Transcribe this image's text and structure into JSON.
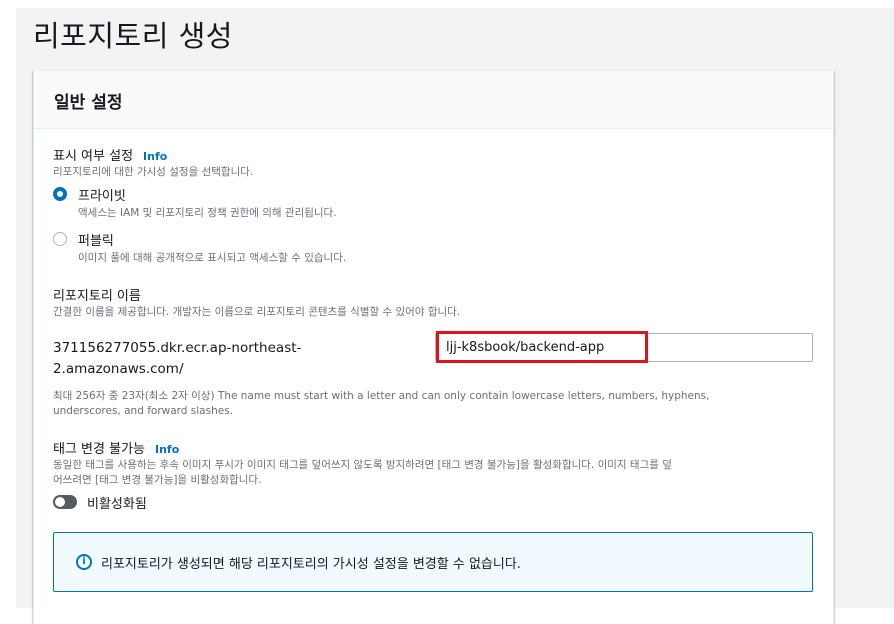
{
  "page": {
    "title": "리포지토리 생성"
  },
  "general_settings": {
    "header": "일반 설정",
    "visibility": {
      "label": "표시 여부 설정",
      "info": "Info",
      "description": "리포지토리에 대한 가시성 설정을 선택합니다.",
      "options": [
        {
          "label": "프라이빗",
          "description": "액세스는 IAM 및 리포지토리 정책 권한에 의해 관리됩니다.",
          "checked": true
        },
        {
          "label": "퍼블릭",
          "description": "이미지 풀에 대해 공개적으로 표시되고 액세스할 수 있습니다.",
          "checked": false
        }
      ]
    },
    "repo_name": {
      "label": "리포지토리 이름",
      "description": "간결한 이름을 제공합니다. 개발자는 이름으로 리포지토리 콘텐츠를 식별할 수 있어야 합니다.",
      "uri_prefix_line1": "371156277055.dkr.ecr.ap-northeast-",
      "uri_prefix_line2": "2.amazonaws.com/",
      "value": "ljj-k8sbook/backend-app",
      "hint_line1": "최대 256자 중 23자(최소 2자 이상) The name must start with a letter and can only contain lowercase letters, numbers, hyphens,",
      "hint_line2": "underscores, and forward slashes."
    },
    "tag_immutability": {
      "label": "태그 변경 불가능",
      "info": "Info",
      "description_line1": "동일한 태그를 사용하는 후속 이미지 푸시가 이미지 태그를 덮어쓰지 않도록 방지하려면 [태그 변경 불가능]을 활성화합니다. 이미지 태그를 덮",
      "description_line2": "어쓰려면 [태그 변경 불가능]을 비활성화합니다.",
      "toggle_label": "비활성화됨",
      "enabled": false
    },
    "alert": {
      "icon": "info-circle-icon",
      "text": "리포지토리가 생성되면 해당 리포지토리의 가시성 설정을 변경할 수 없습니다."
    }
  },
  "colors": {
    "accent": "#0073bb",
    "highlight": "#e0121e",
    "alert_bg": "#f1faff"
  }
}
